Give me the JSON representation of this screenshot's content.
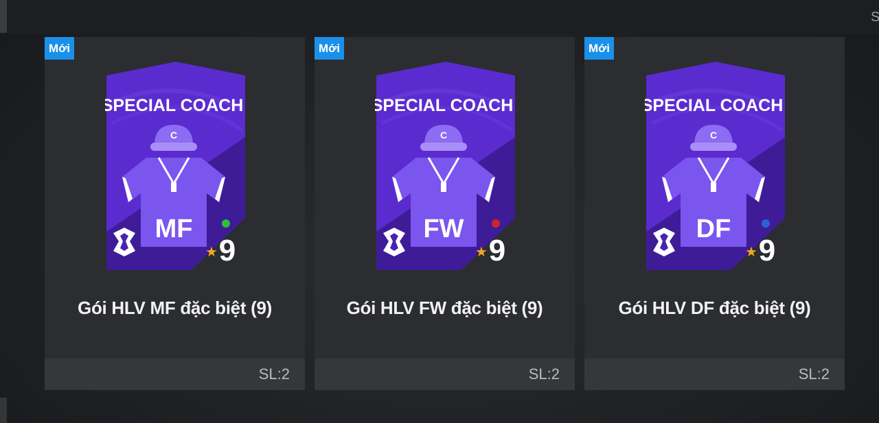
{
  "corner_text": "S",
  "cards": [
    {
      "badge": "Mới",
      "pack_title": "SPECIAL COACH",
      "emblem_letter": "C",
      "position": "MF",
      "level": "9",
      "dot_color": "#2fbf3a",
      "name": "Gói HLV MF đặc biệt (9)",
      "quantity": "SL:2"
    },
    {
      "badge": "Mới",
      "pack_title": "SPECIAL COACH",
      "emblem_letter": "C",
      "position": "FW",
      "level": "9",
      "dot_color": "#d0232a",
      "name": "Gói HLV FW đặc biệt (9)",
      "quantity": "SL:2"
    },
    {
      "badge": "Mới",
      "pack_title": "SPECIAL COACH",
      "emblem_letter": "C",
      "position": "DF",
      "level": "9",
      "dot_color": "#2b63d6",
      "name": "Gói HLV DF đặc biệt (9)",
      "quantity": "SL:2"
    }
  ],
  "colors": {
    "badge_bg": "#1a90e8",
    "pack_purple": "#5b2bd0",
    "pack_dark": "#3a1a8e",
    "star": "#f2a81d"
  }
}
